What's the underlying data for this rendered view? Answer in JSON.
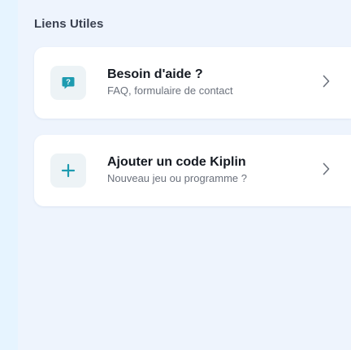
{
  "section": {
    "title": "Liens Utiles"
  },
  "links": [
    {
      "title": "Besoin d'aide ?",
      "subtitle": "FAQ, formulaire de contact",
      "icon": "help-chat-bubble-icon"
    },
    {
      "title": "Ajouter un code Kiplin",
      "subtitle": "Nouveau jeu ou programme ?",
      "icon": "plus-icon"
    }
  ],
  "colors": {
    "accent": "#1e9bb0",
    "background": "#eef4fd"
  }
}
